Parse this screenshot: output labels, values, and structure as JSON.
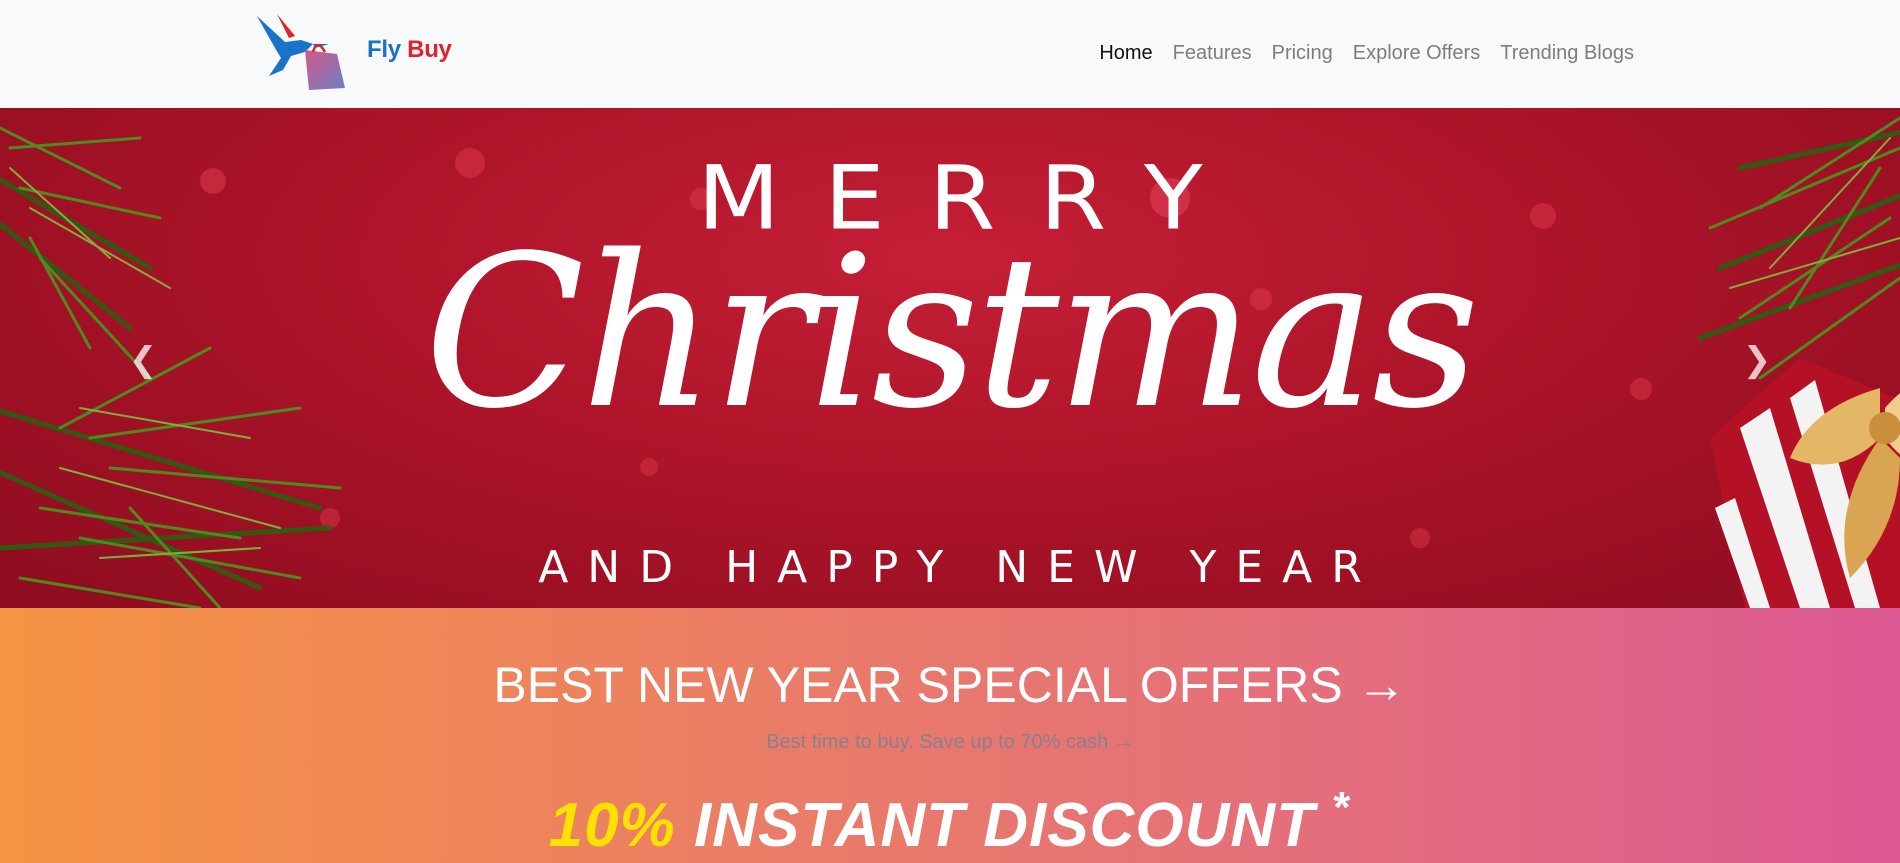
{
  "navbar": {
    "brand": {
      "logo_icon": "hummingbird-shopping-bag-logo",
      "name_part1": "Fly",
      "name_part2": "Buy",
      "colors": {
        "part1": "#1a73c8",
        "part2": "#e0232b"
      }
    },
    "links": [
      {
        "label": "Home",
        "active": true
      },
      {
        "label": "Features",
        "active": false
      },
      {
        "label": "Pricing",
        "active": false
      },
      {
        "label": "Explore Offers",
        "active": false
      },
      {
        "label": "Trending Blogs",
        "active": false
      }
    ]
  },
  "carousel": {
    "slide": {
      "line1": "MERRY",
      "line2": "Christmas",
      "line3": "AND HAPPY NEW YEAR",
      "background_color": "#ad1429"
    },
    "prev_icon": "chevron-left-icon",
    "next_icon": "chevron-right-icon",
    "prev_glyph": "❮",
    "next_glyph": "❯"
  },
  "offers": {
    "title": "BEST NEW YEAR SPECIAL OFFERS →",
    "subtitle": "Best time to buy. Save up to 70% cash →",
    "discount_percent": "10%",
    "discount_text": "INSTANT DISCOUNT",
    "discount_mark": "*",
    "gradient": {
      "start": "#f59443",
      "end": "#dc5893"
    }
  }
}
